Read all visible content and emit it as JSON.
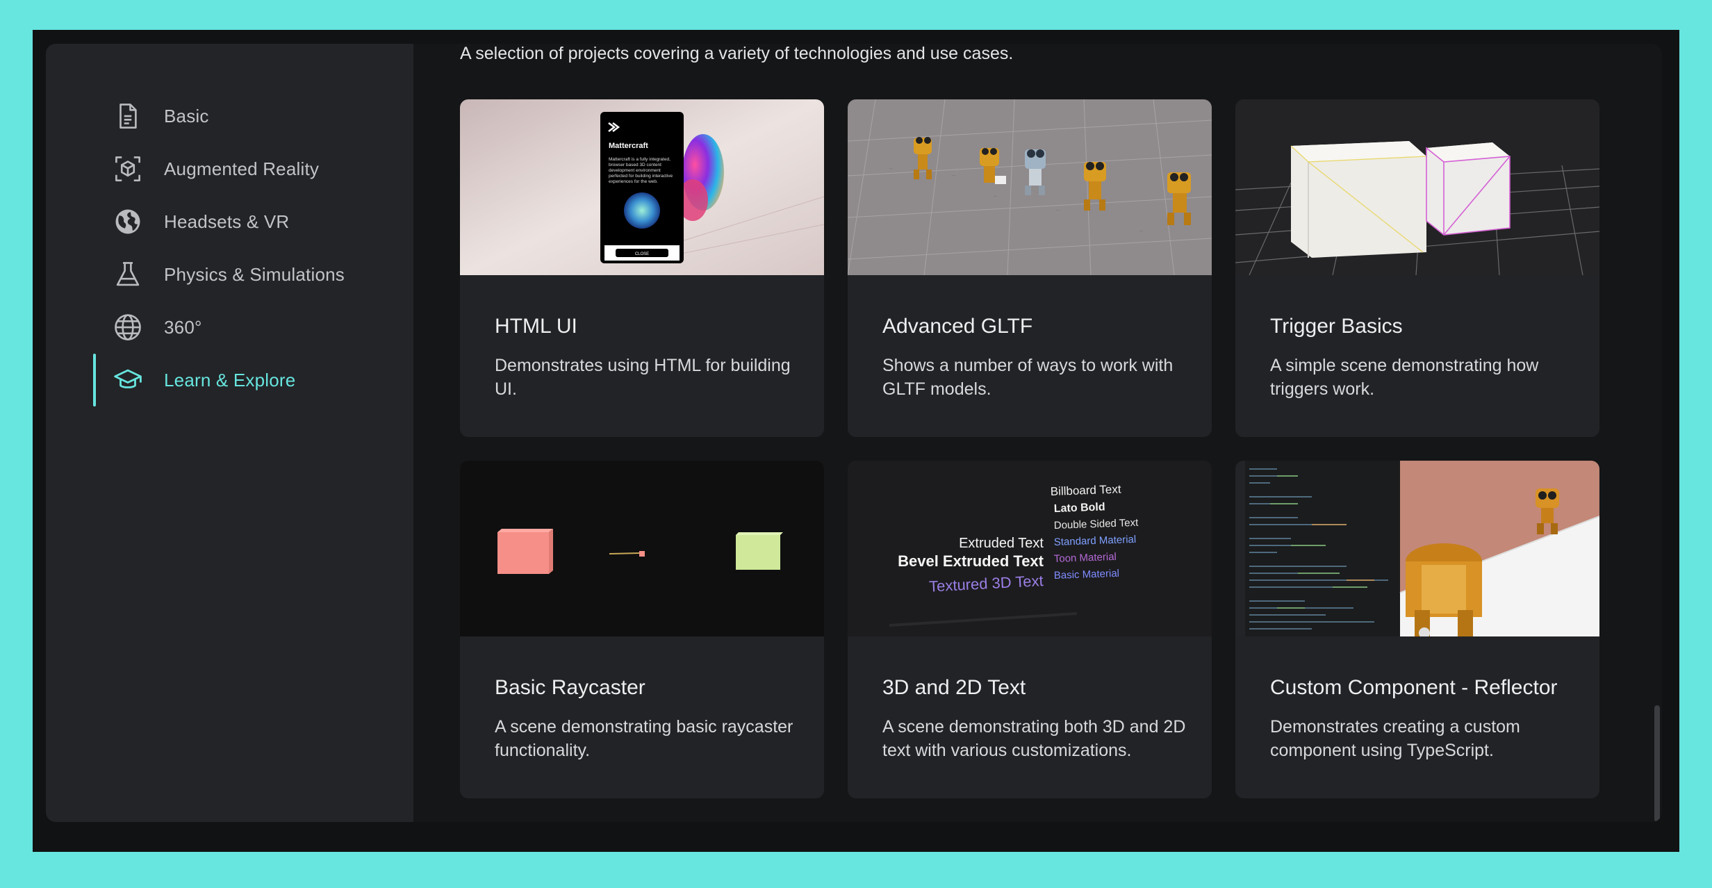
{
  "sidebar": {
    "items": [
      {
        "label": "Basic",
        "icon": "document-icon",
        "active": false
      },
      {
        "label": "Augmented Reality",
        "icon": "ar-cube-icon",
        "active": false
      },
      {
        "label": "Headsets & VR",
        "icon": "globe-filled-icon",
        "active": false
      },
      {
        "label": "Physics & Simulations",
        "icon": "flask-icon",
        "active": false
      },
      {
        "label": "360°",
        "icon": "globe-icon",
        "active": false
      },
      {
        "label": "Learn & Explore",
        "icon": "graduation-cap-icon",
        "active": true
      }
    ]
  },
  "main": {
    "subtitle": "A selection of projects covering a variety of technologies and use cases.",
    "cards": [
      {
        "title": "HTML UI",
        "description": "Demonstrates using HTML for building UI.",
        "thumb": {
          "brand": "Mattercraft",
          "blurb": "Mattercraft is a fully integrated, browser based 3D content development environment perfected for building interactive experiences for the web.",
          "button": "CLOSE"
        }
      },
      {
        "title": "Advanced GLTF",
        "description": "Shows a number of ways to work with GLTF models."
      },
      {
        "title": "Trigger Basics",
        "description": "A simple scene demonstrating how triggers work."
      },
      {
        "title": "Basic Raycaster",
        "description": "A scene demonstrating basic raycaster functionality."
      },
      {
        "title": "3D and 2D Text",
        "description": "A scene demonstrating both 3D and 2D text with various customizations.",
        "thumb": {
          "texts": [
            "Billboard Text",
            "Lato Bold",
            "Double Sided Text",
            "Standard Material",
            "Toon Material",
            "Basic Material",
            "Extruded Text",
            "Bevel Extruded Text",
            "Textured 3D Text"
          ]
        }
      },
      {
        "title": "Custom Component - Reflector",
        "description": "Demonstrates creating a custom component using TypeScript."
      }
    ]
  },
  "colors": {
    "accent": "#67e5df",
    "card_bg": "#222326",
    "sidebar_bg": "#232427"
  }
}
